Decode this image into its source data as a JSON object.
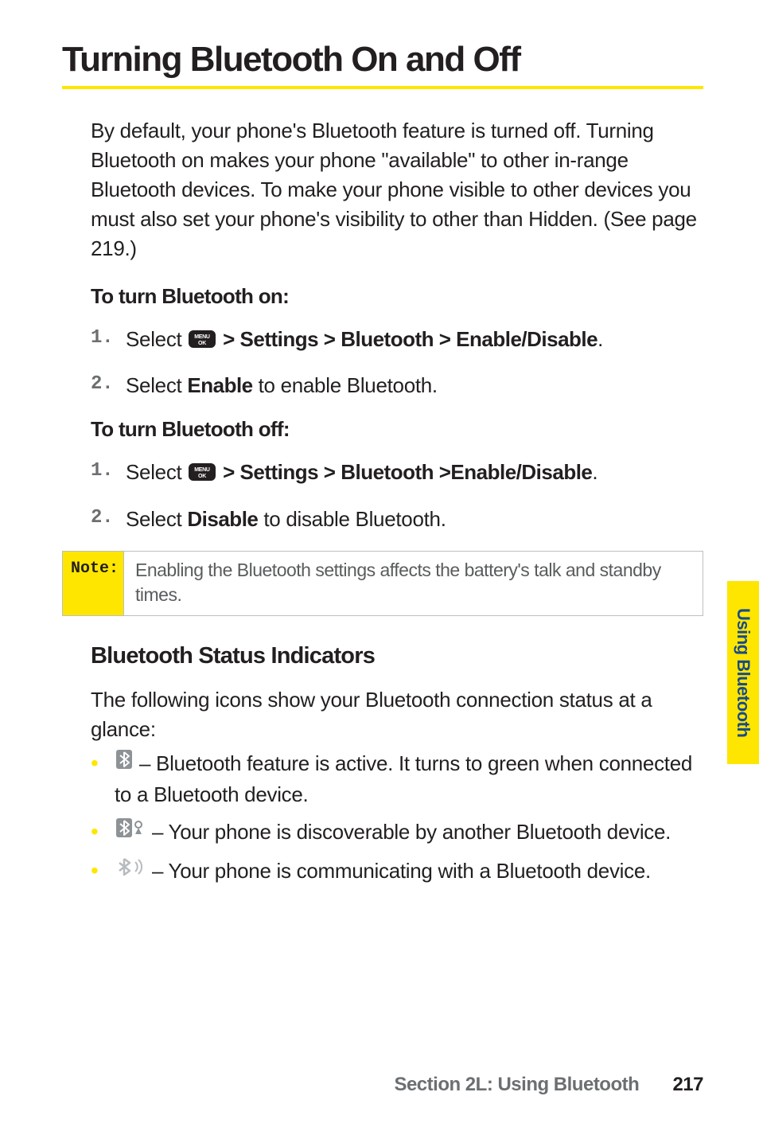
{
  "title": "Turning Bluetooth On and Off",
  "intro": "By default, your phone's Bluetooth feature is turned off. Turning Bluetooth on makes your phone \"available\" to other in-range Bluetooth devices. To make your phone visible to other devices you must also set your phone's visibility to other than Hidden. (See page 219.)",
  "section_on": {
    "heading": "To turn Bluetooth on:",
    "steps": [
      {
        "num": "1.",
        "prefix": "Select ",
        "path": " > Settings > Bluetooth > Enable/Disable",
        "suffix": "."
      },
      {
        "num": "2.",
        "prefix": "Select ",
        "bold": "Enable",
        "suffix": " to enable Bluetooth."
      }
    ]
  },
  "section_off": {
    "heading": "To turn Bluetooth off:",
    "steps": [
      {
        "num": "1.",
        "prefix": "Select ",
        "path": " > Settings > Bluetooth >Enable/Disable",
        "suffix": "."
      },
      {
        "num": "2.",
        "prefix": "Select ",
        "bold": "Disable",
        "suffix": " to disable Bluetooth."
      }
    ]
  },
  "note": {
    "label": "Note:",
    "body": "Enabling the Bluetooth settings affects the battery's talk and standby times."
  },
  "indicators": {
    "heading": "Bluetooth Status Indicators",
    "intro": "The following icons show your Bluetooth connection status at a glance:",
    "items": [
      "– Bluetooth feature is active. It turns to green when connected to a Bluetooth device.",
      "– Your phone is discoverable by another Bluetooth device.",
      "– Your phone is communicating with a Bluetooth device."
    ]
  },
  "side_tab": "Using Bluetooth",
  "footer": {
    "section": "Section 2L: Using Bluetooth",
    "page": "217"
  },
  "icons": {
    "menu_key_label": "MENU OK"
  }
}
